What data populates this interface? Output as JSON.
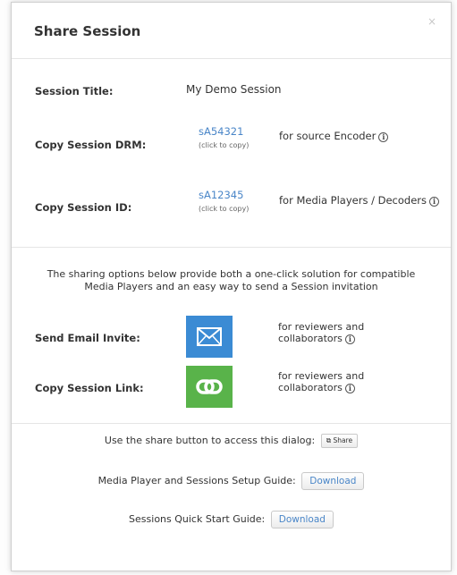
{
  "dialog": {
    "title": "Share Session",
    "close_icon": "×"
  },
  "session": {
    "title_label": "Session Title:",
    "title_value": "My Demo Session",
    "drm_label": "Copy Session DRM:",
    "drm_code": "sA54321",
    "drm_hint": "(click to copy)",
    "drm_desc": "for source Encoder",
    "id_label": "Copy Session ID:",
    "id_code": "sA12345",
    "id_hint": "(click to copy)",
    "id_desc": "for Media Players / Decoders"
  },
  "sharing": {
    "intro_line1": "The sharing options below provide both a one-click solution for compatible",
    "intro_line2": "Media Players and an easy way to send a Session invitation",
    "email_label": "Send Email Invite:",
    "email_desc_line1": "for reviewers and",
    "email_desc_line2": "collaborators",
    "link_label": "Copy Session Link:",
    "link_desc_line1": "for reviewers and",
    "link_desc_line2": "collaborators",
    "email_icon": "envelope-icon",
    "link_icon": "chain-link-icon"
  },
  "footer": {
    "share_text": "Use the share button to access this dialog:",
    "share_button": "Share",
    "setup_text": "Media Player and Sessions Setup Guide:",
    "setup_button": "Download",
    "quick_text": "Sessions Quick Start Guide:",
    "quick_button": "Download"
  },
  "colors": {
    "link": "#4a86c8",
    "email_tile": "#3b8bd4",
    "link_tile": "#59b34a"
  }
}
